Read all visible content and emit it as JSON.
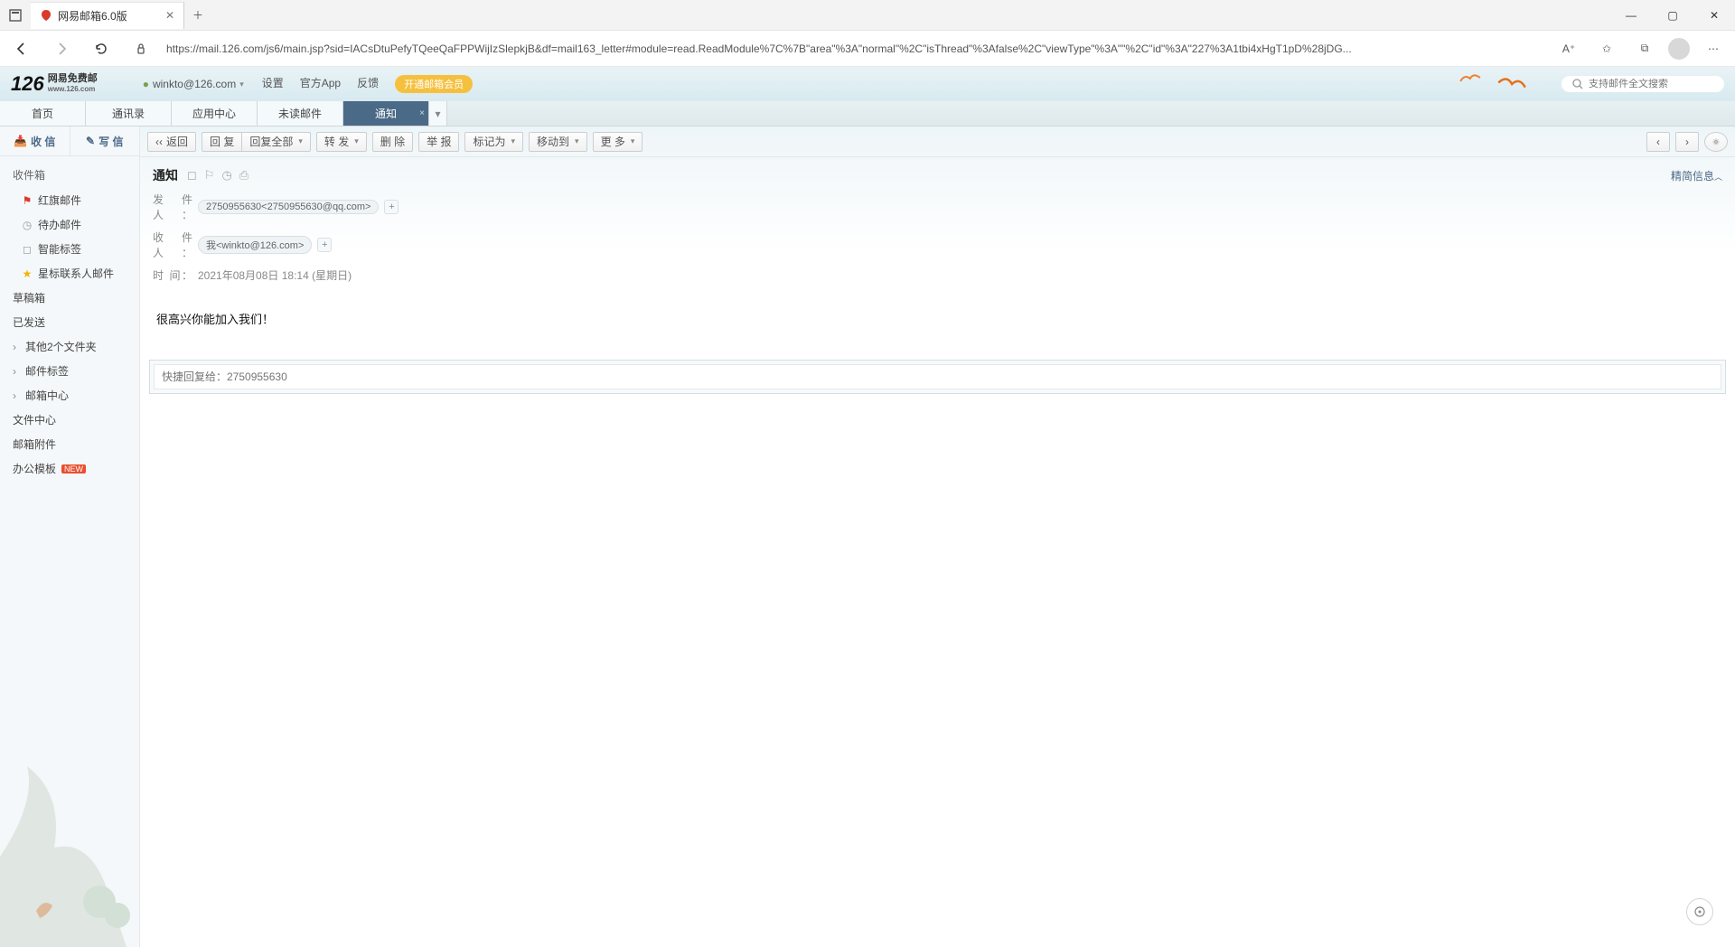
{
  "browser": {
    "tab_title": "网易邮箱6.0版",
    "url": "https://mail.126.com/js6/main.jsp?sid=IACsDtuPefyTQeeQaFPPWijIzSlepkjB&df=mail163_letter#module=read.ReadModule%7C%7B\"area\"%3A\"normal\"%2C\"isThread\"%3Afalse%2C\"viewType\"%3A\"\"%2C\"id\"%3A\"227%3A1tbi4xHgT1pD%28jDG..."
  },
  "header": {
    "logo_num": "126",
    "logo_line1": "网易免费邮",
    "logo_line2": "www.126.com",
    "user": "winkto@126.com",
    "links": {
      "settings": "设置",
      "app": "官方App",
      "feedback": "反馈",
      "vip": "开通邮箱会员"
    },
    "search_placeholder": "支持邮件全文搜索"
  },
  "tabs": {
    "home": "首页",
    "contacts": "通讯录",
    "apps": "应用中心",
    "unread": "未读邮件",
    "notice": "通知"
  },
  "sidebar": {
    "receive": "收 信",
    "compose": "写 信",
    "inbox": "收件箱",
    "flag": "红旗邮件",
    "todo": "待办邮件",
    "smart": "智能标签",
    "star": "星标联系人邮件",
    "draft": "草稿箱",
    "sent": "已发送",
    "other": "其他2个文件夹",
    "tags": "邮件标签",
    "center": "邮箱中心",
    "files": "文件中心",
    "attach": "邮箱附件",
    "office": "办公模板",
    "new": "NEW"
  },
  "toolbar": {
    "back": "返回",
    "reply": "回 复",
    "reply_all": "回复全部",
    "forward": "转 发",
    "delete": "删 除",
    "spam": "举 报",
    "mark": "标记为",
    "move": "移动到",
    "more": "更 多"
  },
  "mail": {
    "subject": "通知",
    "summary": "精简信息",
    "sender_label": "发件人：",
    "sender": "2750955630<2750955630@qq.com>",
    "recipient_label": "收件人：",
    "recipient": "我<winkto@126.com>",
    "time_label": "时   间：",
    "time": "2021年08月08日 18:14 (星期日)",
    "body": "很高兴你能加入我们！",
    "quick_reply_placeholder": "快捷回复给：2750955630"
  }
}
